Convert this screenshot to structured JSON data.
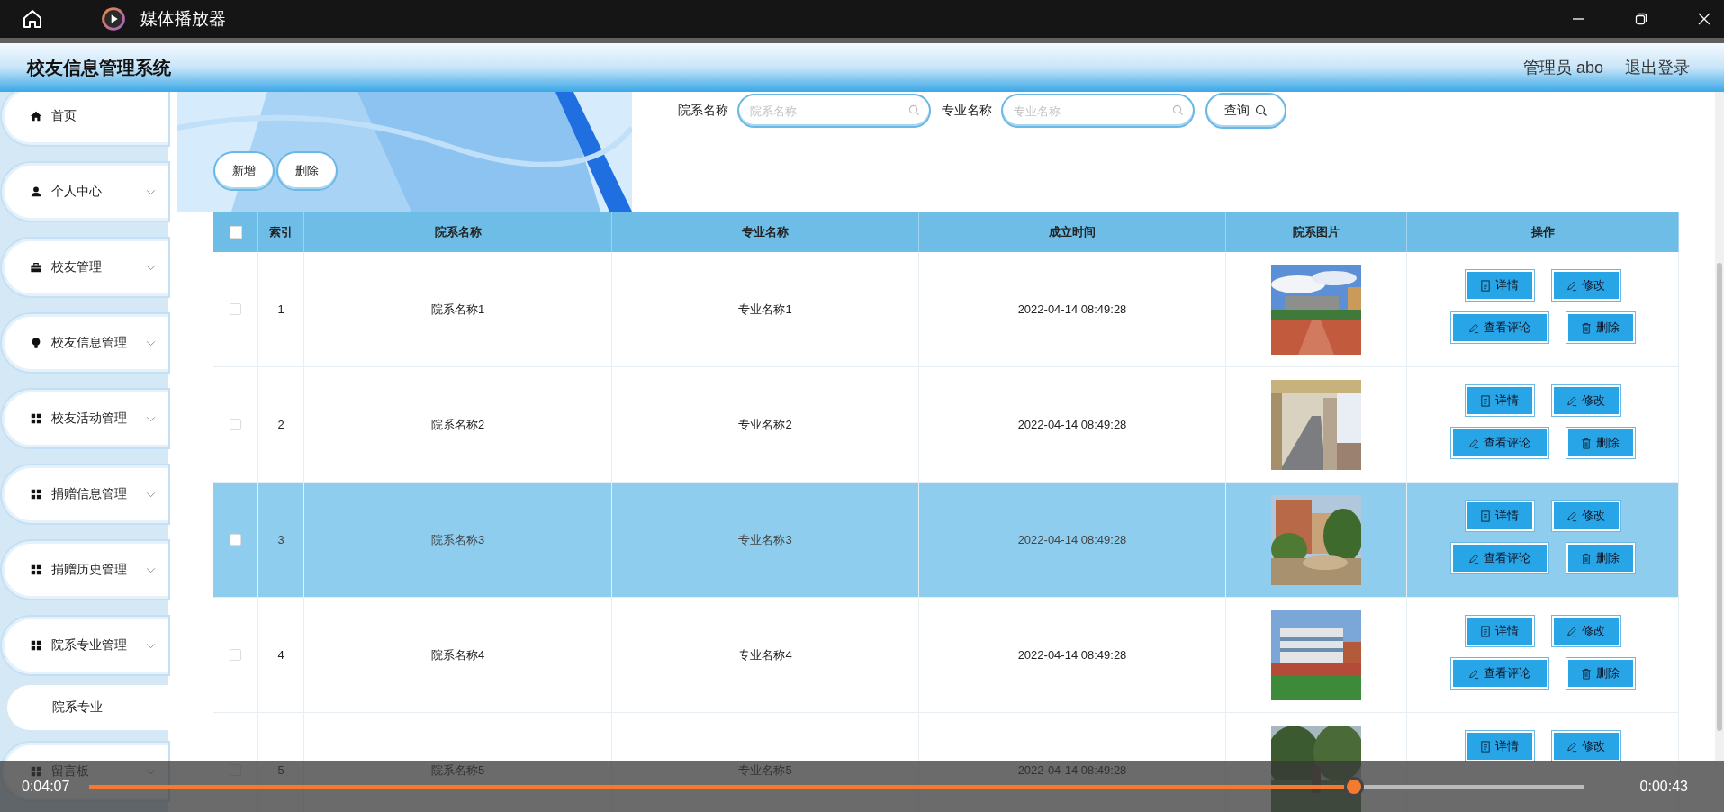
{
  "player": {
    "title": "媒体播放器",
    "elapsed": "0:04:07",
    "remaining": "0:00:43",
    "level": 0.846
  },
  "app": {
    "title": "校友信息管理系统",
    "user": "管理员 abo",
    "logout": "退出登录"
  },
  "sidebar": {
    "items": [
      {
        "label": "首页",
        "kind": "home",
        "expandable": false
      },
      {
        "label": "个人中心",
        "kind": "user",
        "expandable": true
      },
      {
        "label": "校友管理",
        "kind": "briefcase",
        "expandable": true
      },
      {
        "label": "校友信息管理",
        "kind": "bulb",
        "expandable": true
      },
      {
        "label": "校友活动管理",
        "kind": "grid",
        "expandable": true
      },
      {
        "label": "捐赠信息管理",
        "kind": "grid",
        "expandable": true
      },
      {
        "label": "捐赠历史管理",
        "kind": "grid",
        "expandable": true
      },
      {
        "label": "院系专业管理",
        "kind": "grid",
        "expandable": true,
        "children": [
          {
            "label": "院系专业"
          }
        ]
      },
      {
        "label": "留言板",
        "kind": "grid",
        "expandable": true
      }
    ]
  },
  "search": {
    "fields": [
      {
        "label": "院系名称",
        "placeholder": "院系名称"
      },
      {
        "label": "专业名称",
        "placeholder": "专业名称"
      }
    ],
    "button": "查询"
  },
  "toolbar": [
    "新增",
    "删除"
  ],
  "table": {
    "header_checked": false,
    "columns": [
      "索引",
      "院系名称",
      "专业名称",
      "成立时间",
      "院系图片",
      "操作"
    ],
    "rows": [
      {
        "index": "1",
        "department": "院系名称1",
        "major": "专业名称1",
        "founded": "2022-04-14 08:49:28",
        "checked": false,
        "selected": false,
        "image": {
          "kind": "picture"
        },
        "actions": [
          {
            "label": "详情",
            "kind": "detail"
          },
          {
            "label": "修改",
            "kind": "edit"
          },
          {
            "label": "查看评论",
            "kind": "comment"
          },
          {
            "label": "删除",
            "kind": "delete"
          }
        ]
      },
      {
        "index": "2",
        "department": "院系名称2",
        "major": "专业名称2",
        "founded": "2022-04-14 08:49:28",
        "checked": false,
        "selected": false,
        "image": {
          "kind": "picture"
        },
        "actions": [
          {
            "label": "详情",
            "kind": "detail"
          },
          {
            "label": "修改",
            "kind": "edit"
          },
          {
            "label": "查看评论",
            "kind": "comment"
          },
          {
            "label": "删除",
            "kind": "delete"
          }
        ]
      },
      {
        "index": "3",
        "department": "院系名称3",
        "major": "专业名称3",
        "founded": "2022-04-14 08:49:28",
        "checked": false,
        "selected": true,
        "image": {
          "kind": "picture"
        },
        "actions": [
          {
            "label": "详情",
            "kind": "detail"
          },
          {
            "label": "修改",
            "kind": "edit"
          },
          {
            "label": "查看评论",
            "kind": "comment"
          },
          {
            "label": "删除",
            "kind": "delete"
          }
        ]
      },
      {
        "index": "4",
        "department": "院系名称4",
        "major": "专业名称4",
        "founded": "2022-04-14 08:49:28",
        "checked": false,
        "selected": false,
        "image": {
          "kind": "picture"
        },
        "actions": [
          {
            "label": "详情",
            "kind": "detail"
          },
          {
            "label": "修改",
            "kind": "edit"
          },
          {
            "label": "查看评论",
            "kind": "comment"
          },
          {
            "label": "删除",
            "kind": "delete"
          }
        ]
      },
      {
        "index": "5",
        "department": "院系名称5",
        "major": "专业名称5",
        "founded": "2022-04-14 08:49:28",
        "checked": false,
        "selected": false,
        "image": {
          "kind": "picture"
        },
        "actions": [
          {
            "label": "详情",
            "kind": "detail"
          },
          {
            "label": "修改",
            "kind": "edit"
          }
        ]
      }
    ]
  }
}
